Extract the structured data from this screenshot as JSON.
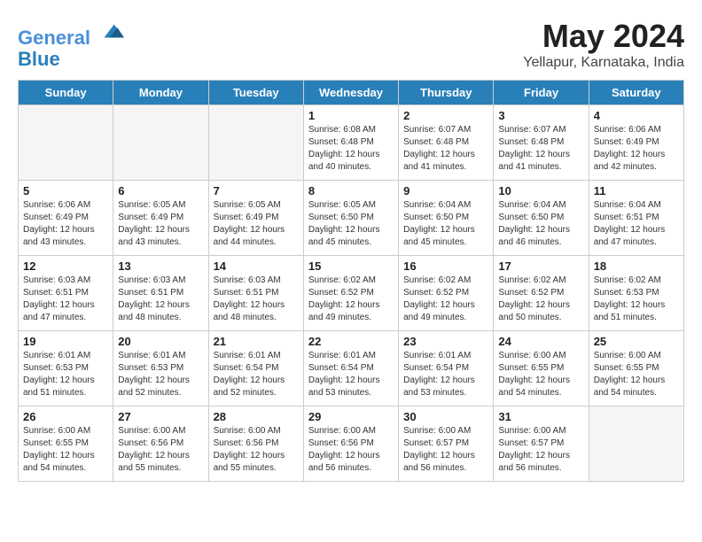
{
  "header": {
    "logo_line1": "General",
    "logo_line2": "Blue",
    "title": "May 2024",
    "subtitle": "Yellapur, Karnataka, India"
  },
  "calendar": {
    "days_of_week": [
      "Sunday",
      "Monday",
      "Tuesday",
      "Wednesday",
      "Thursday",
      "Friday",
      "Saturday"
    ],
    "weeks": [
      [
        {
          "day": "",
          "info": ""
        },
        {
          "day": "",
          "info": ""
        },
        {
          "day": "",
          "info": ""
        },
        {
          "day": "1",
          "info": "Sunrise: 6:08 AM\nSunset: 6:48 PM\nDaylight: 12 hours\nand 40 minutes."
        },
        {
          "day": "2",
          "info": "Sunrise: 6:07 AM\nSunset: 6:48 PM\nDaylight: 12 hours\nand 41 minutes."
        },
        {
          "day": "3",
          "info": "Sunrise: 6:07 AM\nSunset: 6:48 PM\nDaylight: 12 hours\nand 41 minutes."
        },
        {
          "day": "4",
          "info": "Sunrise: 6:06 AM\nSunset: 6:49 PM\nDaylight: 12 hours\nand 42 minutes."
        }
      ],
      [
        {
          "day": "5",
          "info": "Sunrise: 6:06 AM\nSunset: 6:49 PM\nDaylight: 12 hours\nand 43 minutes."
        },
        {
          "day": "6",
          "info": "Sunrise: 6:05 AM\nSunset: 6:49 PM\nDaylight: 12 hours\nand 43 minutes."
        },
        {
          "day": "7",
          "info": "Sunrise: 6:05 AM\nSunset: 6:49 PM\nDaylight: 12 hours\nand 44 minutes."
        },
        {
          "day": "8",
          "info": "Sunrise: 6:05 AM\nSunset: 6:50 PM\nDaylight: 12 hours\nand 45 minutes."
        },
        {
          "day": "9",
          "info": "Sunrise: 6:04 AM\nSunset: 6:50 PM\nDaylight: 12 hours\nand 45 minutes."
        },
        {
          "day": "10",
          "info": "Sunrise: 6:04 AM\nSunset: 6:50 PM\nDaylight: 12 hours\nand 46 minutes."
        },
        {
          "day": "11",
          "info": "Sunrise: 6:04 AM\nSunset: 6:51 PM\nDaylight: 12 hours\nand 47 minutes."
        }
      ],
      [
        {
          "day": "12",
          "info": "Sunrise: 6:03 AM\nSunset: 6:51 PM\nDaylight: 12 hours\nand 47 minutes."
        },
        {
          "day": "13",
          "info": "Sunrise: 6:03 AM\nSunset: 6:51 PM\nDaylight: 12 hours\nand 48 minutes."
        },
        {
          "day": "14",
          "info": "Sunrise: 6:03 AM\nSunset: 6:51 PM\nDaylight: 12 hours\nand 48 minutes."
        },
        {
          "day": "15",
          "info": "Sunrise: 6:02 AM\nSunset: 6:52 PM\nDaylight: 12 hours\nand 49 minutes."
        },
        {
          "day": "16",
          "info": "Sunrise: 6:02 AM\nSunset: 6:52 PM\nDaylight: 12 hours\nand 49 minutes."
        },
        {
          "day": "17",
          "info": "Sunrise: 6:02 AM\nSunset: 6:52 PM\nDaylight: 12 hours\nand 50 minutes."
        },
        {
          "day": "18",
          "info": "Sunrise: 6:02 AM\nSunset: 6:53 PM\nDaylight: 12 hours\nand 51 minutes."
        }
      ],
      [
        {
          "day": "19",
          "info": "Sunrise: 6:01 AM\nSunset: 6:53 PM\nDaylight: 12 hours\nand 51 minutes."
        },
        {
          "day": "20",
          "info": "Sunrise: 6:01 AM\nSunset: 6:53 PM\nDaylight: 12 hours\nand 52 minutes."
        },
        {
          "day": "21",
          "info": "Sunrise: 6:01 AM\nSunset: 6:54 PM\nDaylight: 12 hours\nand 52 minutes."
        },
        {
          "day": "22",
          "info": "Sunrise: 6:01 AM\nSunset: 6:54 PM\nDaylight: 12 hours\nand 53 minutes."
        },
        {
          "day": "23",
          "info": "Sunrise: 6:01 AM\nSunset: 6:54 PM\nDaylight: 12 hours\nand 53 minutes."
        },
        {
          "day": "24",
          "info": "Sunrise: 6:00 AM\nSunset: 6:55 PM\nDaylight: 12 hours\nand 54 minutes."
        },
        {
          "day": "25",
          "info": "Sunrise: 6:00 AM\nSunset: 6:55 PM\nDaylight: 12 hours\nand 54 minutes."
        }
      ],
      [
        {
          "day": "26",
          "info": "Sunrise: 6:00 AM\nSunset: 6:55 PM\nDaylight: 12 hours\nand 54 minutes."
        },
        {
          "day": "27",
          "info": "Sunrise: 6:00 AM\nSunset: 6:56 PM\nDaylight: 12 hours\nand 55 minutes."
        },
        {
          "day": "28",
          "info": "Sunrise: 6:00 AM\nSunset: 6:56 PM\nDaylight: 12 hours\nand 55 minutes."
        },
        {
          "day": "29",
          "info": "Sunrise: 6:00 AM\nSunset: 6:56 PM\nDaylight: 12 hours\nand 56 minutes."
        },
        {
          "day": "30",
          "info": "Sunrise: 6:00 AM\nSunset: 6:57 PM\nDaylight: 12 hours\nand 56 minutes."
        },
        {
          "day": "31",
          "info": "Sunrise: 6:00 AM\nSunset: 6:57 PM\nDaylight: 12 hours\nand 56 minutes."
        },
        {
          "day": "",
          "info": ""
        }
      ]
    ]
  }
}
